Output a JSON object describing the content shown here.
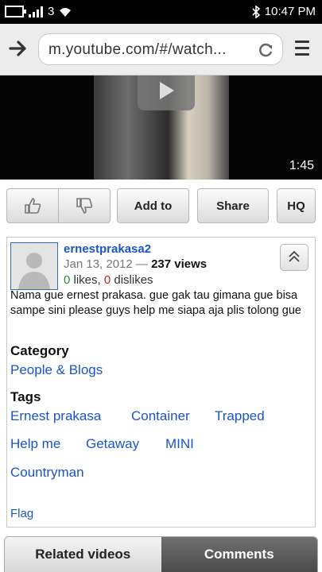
{
  "status_bar": {
    "carrier_badge": "3",
    "time": "10:47 PM"
  },
  "browser": {
    "url": "m.youtube.com/#/watch..."
  },
  "video": {
    "duration": "1:45"
  },
  "actions": {
    "add_to": "Add to",
    "share": "Share",
    "hq": "HQ"
  },
  "info": {
    "username": "ernestprakasa2",
    "date": "Jan 13, 2012",
    "separator": " — ",
    "views": "237 views",
    "likes_count": "0",
    "likes_label": " likes, ",
    "dislikes_count": "0",
    "dislikes_label": " dislikes",
    "description": "Nama gue ernest prakasa. gue gak tau gimana gue bisa sampe sini please guys help me siapa aja plis tolong gue"
  },
  "category": {
    "heading": "Category",
    "value": "People & Blogs"
  },
  "tags": {
    "heading": "Tags",
    "items": [
      "Ernest prakasa",
      "Container",
      "Trapped",
      "Help me",
      "Getaway",
      "MINI",
      "Countryman"
    ]
  },
  "flag_label": "Flag",
  "tabs": {
    "related": "Related videos",
    "comments": "Comments"
  }
}
